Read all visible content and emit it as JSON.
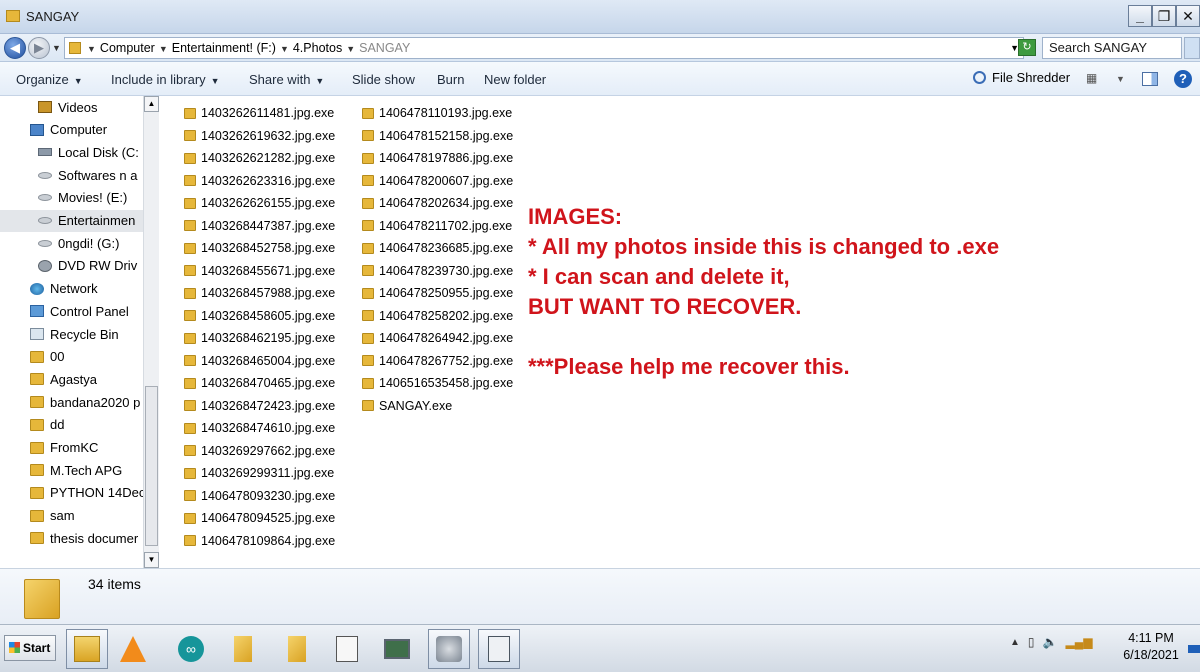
{
  "window": {
    "title": "SANGAY"
  },
  "window_controls": {
    "minimize": "_",
    "restore": "❐",
    "close": "✕"
  },
  "address": {
    "crumbs": [
      "Computer",
      "Entertainment! (F:)",
      "4.Photos",
      "SANGAY"
    ],
    "search_placeholder": "Search SANGAY"
  },
  "toolbar": {
    "organize": "Organize",
    "include_in_library": "Include in library",
    "share_with": "Share with",
    "slide_show": "Slide show",
    "burn": "Burn",
    "new_folder": "New folder",
    "file_shredder": "File Shredder"
  },
  "nav": {
    "items": [
      {
        "label": "Videos",
        "icon": "video"
      },
      {
        "label": "Computer",
        "icon": "computer"
      },
      {
        "label": "Local Disk (C:",
        "icon": "disk"
      },
      {
        "label": "Softwares n a",
        "icon": "drive"
      },
      {
        "label": "Movies! (E:)",
        "icon": "drive"
      },
      {
        "label": "Entertainmen",
        "icon": "drive"
      },
      {
        "label": "0ngdi! (G:)",
        "icon": "drive"
      },
      {
        "label": "DVD RW Driv",
        "icon": "dvd"
      },
      {
        "label": "Network",
        "icon": "network"
      },
      {
        "label": "Control Panel",
        "icon": "control"
      },
      {
        "label": "Recycle Bin",
        "icon": "recycle"
      },
      {
        "label": "00",
        "icon": "folder"
      },
      {
        "label": "Agastya",
        "icon": "folder"
      },
      {
        "label": "bandana2020 p",
        "icon": "folder"
      },
      {
        "label": "dd",
        "icon": "folder"
      },
      {
        "label": "FromKC",
        "icon": "folder"
      },
      {
        "label": "M.Tech APG",
        "icon": "folder"
      },
      {
        "label": "PYTHON 14Dec",
        "icon": "folder"
      },
      {
        "label": "sam",
        "icon": "folder"
      },
      {
        "label": "thesis documer",
        "icon": "folder"
      }
    ]
  },
  "files": {
    "col1": [
      "1403262611481.jpg.exe",
      "1403262619632.jpg.exe",
      "1403262621282.jpg.exe",
      "1403262623316.jpg.exe",
      "1403262626155.jpg.exe",
      "1403268447387.jpg.exe",
      "1403268452758.jpg.exe",
      "1403268455671.jpg.exe",
      "1403268457988.jpg.exe",
      "1403268458605.jpg.exe",
      "1403268462195.jpg.exe",
      "1403268465004.jpg.exe",
      "1403268470465.jpg.exe",
      "1403268472423.jpg.exe",
      "1403268474610.jpg.exe",
      "1403269297662.jpg.exe",
      "1403269299311.jpg.exe",
      "1406478093230.jpg.exe",
      "1406478094525.jpg.exe",
      "1406478109864.jpg.exe"
    ],
    "col2": [
      "1406478110193.jpg.exe",
      "1406478152158.jpg.exe",
      "1406478197886.jpg.exe",
      "1406478200607.jpg.exe",
      "1406478202634.jpg.exe",
      "1406478211702.jpg.exe",
      "1406478236685.jpg.exe",
      "1406478239730.jpg.exe",
      "1406478250955.jpg.exe",
      "1406478258202.jpg.exe",
      "1406478264942.jpg.exe",
      "1406478267752.jpg.exe",
      "1406516535458.jpg.exe",
      "SANGAY.exe"
    ]
  },
  "annotation": {
    "line1": "IMAGES:",
    "line2": "* All my photos inside this is changed to .exe",
    "line3": "* I can scan and delete it,",
    "line4": "BUT WANT TO RECOVER.",
    "line5": "***Please help me recover this."
  },
  "details": {
    "item_count": "34 items"
  },
  "taskbar": {
    "start": "Start",
    "time": "4:11 PM",
    "date": "6/18/2021"
  },
  "colors": {
    "annotation": "#d0141b",
    "folder": "#e6b73a"
  }
}
